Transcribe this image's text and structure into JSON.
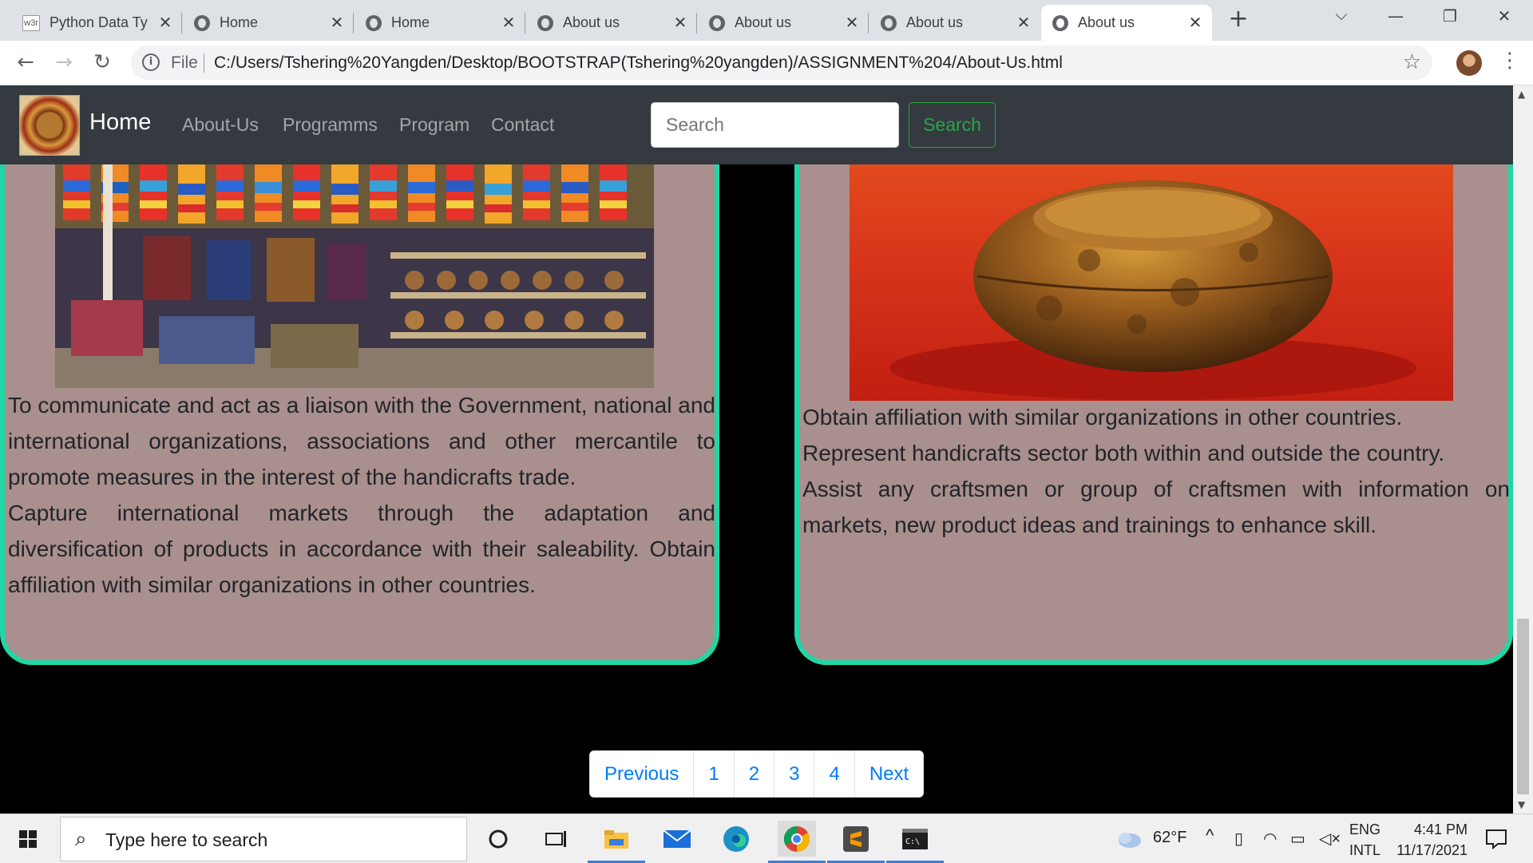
{
  "browser": {
    "tabs": [
      {
        "title": "Python Data Ty",
        "favicon": "w3",
        "active": false
      },
      {
        "title": "Home",
        "favicon": "globe-icon",
        "active": false
      },
      {
        "title": "Home",
        "favicon": "globe-icon",
        "active": false
      },
      {
        "title": "About us",
        "favicon": "globe-icon",
        "active": false
      },
      {
        "title": "About us",
        "favicon": "globe-icon",
        "active": false
      },
      {
        "title": "About us",
        "favicon": "globe-icon",
        "active": false
      },
      {
        "title": "About us",
        "favicon": "globe-icon",
        "active": true
      }
    ],
    "scheme_label": "File",
    "url": "C:/Users/Tshering%20Yangden/Desktop/BOOTSTRAP(Tshering%20yangden)/ASSIGNMENT%204/About-Us.html"
  },
  "navbar": {
    "brand": "Home",
    "links": [
      "About-Us",
      "Programms",
      "Program",
      "Contact"
    ],
    "search_placeholder": "Search",
    "search_button": "Search"
  },
  "cards": {
    "left": {
      "paragraphs": [
        "To communicate and act as a liaison with the Government, national and international organizations, associations and other mercantile to promote measures in the interest of the handicrafts trade.",
        "Capture international markets through the adaptation and diversification of products in accordance with their saleability. Obtain affiliation with similar organizations in other countries."
      ]
    },
    "right": {
      "paragraphs": [
        "Obtain affiliation with similar organizations in other countries.",
        "Represent handicrafts sector both within and outside the country.",
        "Assist any craftsmen or group of craftsmen with information on markets, new product ideas and trainings to enhance skill."
      ]
    }
  },
  "pagination": {
    "previous": "Previous",
    "pages": [
      "1",
      "2",
      "3",
      "4"
    ],
    "next": "Next"
  },
  "taskbar": {
    "search_placeholder": "Type here to search",
    "weather": "62°F",
    "lang_top": "ENG",
    "lang_bottom": "INTL",
    "time": "4:41 PM",
    "date": "11/17/2021"
  },
  "colors": {
    "navbar_bg": "#343a40",
    "card_bg": "#a98f8d",
    "card_border": "#21d6a5",
    "success": "#28a745",
    "link": "#007bff"
  }
}
